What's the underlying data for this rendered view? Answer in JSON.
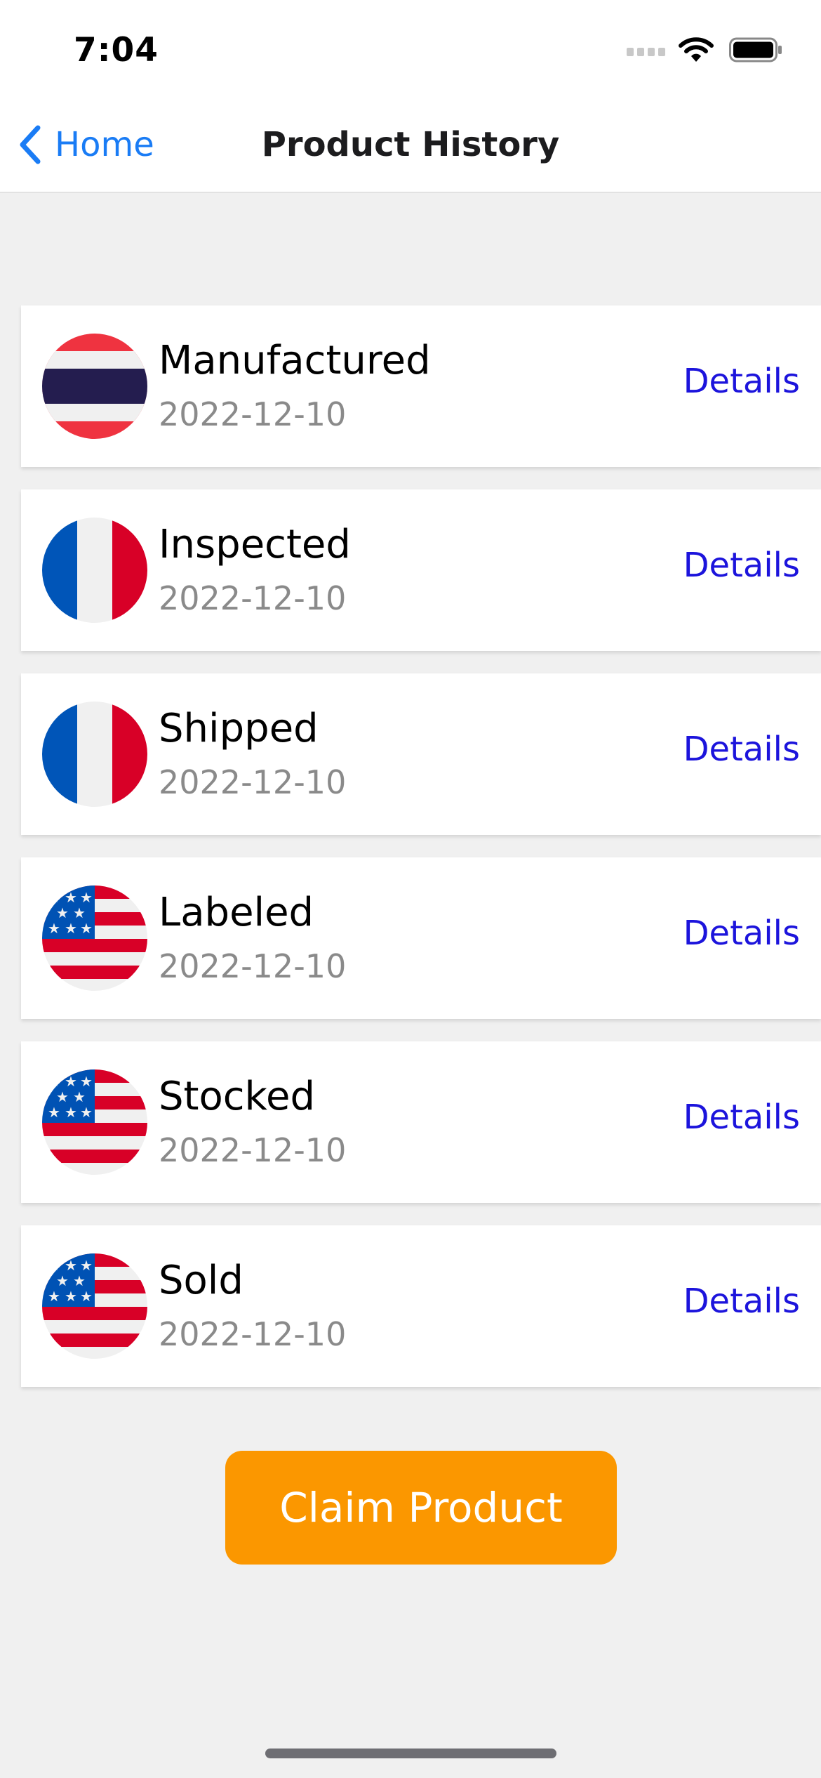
{
  "status_bar": {
    "time": "7:04",
    "icons": [
      "signal-icon",
      "wifi-icon",
      "battery-icon"
    ]
  },
  "nav": {
    "back_label": "Home",
    "title": "Product History"
  },
  "history": [
    {
      "status": "Manufactured",
      "date": "2022-12-10",
      "flag": "thailand-flag-icon",
      "action": "Details"
    },
    {
      "status": "Inspected",
      "date": "2022-12-10",
      "flag": "france-flag-icon",
      "action": "Details"
    },
    {
      "status": "Shipped",
      "date": "2022-12-10",
      "flag": "france-flag-icon",
      "action": "Details"
    },
    {
      "status": "Labeled",
      "date": "2022-12-10",
      "flag": "usa-flag-icon",
      "action": "Details"
    },
    {
      "status": "Stocked",
      "date": "2022-12-10",
      "flag": "usa-flag-icon",
      "action": "Details"
    },
    {
      "status": "Sold",
      "date": "2022-12-10",
      "flag": "usa-flag-icon",
      "action": "Details"
    }
  ],
  "claim_button_label": "Claim Product",
  "colors": {
    "accent_blue": "#1a7cf5",
    "details_blue": "#1c14dc",
    "claim_orange": "#fb9700",
    "date_gray": "#8a8a8a",
    "background": "#f0f0f0"
  }
}
